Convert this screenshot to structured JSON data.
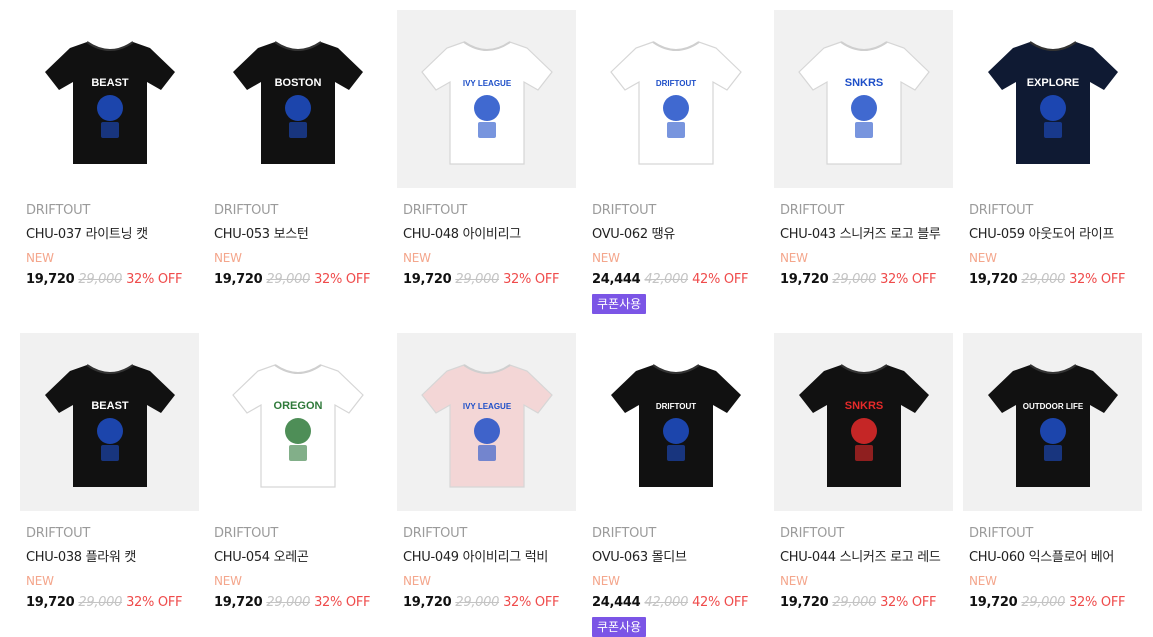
{
  "products": [
    {
      "brand": "DRIFTOUT",
      "name": "CHU-037 라이트닝 캣",
      "badge": "NEW",
      "price": "19,720",
      "original_price": "29,000",
      "discount": "32% OFF",
      "coupon": "",
      "shirt_color": "#111111",
      "bg": "white",
      "print_text": "BEAST",
      "icon": "black-tshirt-cat-print-icon"
    },
    {
      "brand": "DRIFTOUT",
      "name": "CHU-053 보스턴",
      "badge": "NEW",
      "price": "19,720",
      "original_price": "29,000",
      "discount": "32% OFF",
      "coupon": "",
      "shirt_color": "#111111",
      "bg": "white",
      "print_text": "BOSTON",
      "icon": "model-black-tshirt-bear-icon"
    },
    {
      "brand": "DRIFTOUT",
      "name": "CHU-048 아이비리그",
      "badge": "NEW",
      "price": "19,720",
      "original_price": "29,000",
      "discount": "32% OFF",
      "coupon": "",
      "shirt_color": "#ffffff",
      "bg": "grey",
      "print_text": "IVY LEAGUE",
      "icon": "model-white-tshirt-bear-icon"
    },
    {
      "brand": "DRIFTOUT",
      "name": "OVU-062 땡유",
      "badge": "NEW",
      "price": "24,444",
      "original_price": "42,000",
      "discount": "42% OFF",
      "coupon": "쿠폰사용",
      "shirt_color": "#ffffff",
      "bg": "white",
      "print_text": "DRIFTOUT",
      "icon": "white-tshirt-blue-v-icon"
    },
    {
      "brand": "DRIFTOUT",
      "name": "CHU-043 스니커즈 로고 블루",
      "badge": "NEW",
      "price": "19,720",
      "original_price": "29,000",
      "discount": "32% OFF",
      "coupon": "",
      "shirt_color": "#ffffff",
      "bg": "grey",
      "print_text": "SNKRS",
      "icon": "model-white-tshirt-snkrs-icon"
    },
    {
      "brand": "DRIFTOUT",
      "name": "CHU-059 아웃도어 라이프",
      "badge": "NEW",
      "price": "19,720",
      "original_price": "29,000",
      "discount": "32% OFF",
      "coupon": "",
      "shirt_color": "#0f1a33",
      "bg": "white",
      "print_text": "EXPLORE",
      "icon": "navy-tshirt-outdoor-print-icon"
    },
    {
      "brand": "DRIFTOUT",
      "name": "CHU-038 플라워 캣",
      "badge": "NEW",
      "price": "19,720",
      "original_price": "29,000",
      "discount": "32% OFF",
      "coupon": "",
      "shirt_color": "#111111",
      "bg": "grey",
      "print_text": "BEAST",
      "icon": "model-black-tshirt-flower-cat-icon"
    },
    {
      "brand": "DRIFTOUT",
      "name": "CHU-054 오레곤",
      "badge": "NEW",
      "price": "19,720",
      "original_price": "29,000",
      "discount": "32% OFF",
      "coupon": "",
      "shirt_color": "#ffffff",
      "bg": "white",
      "print_text": "OREGON",
      "icon": "white-tshirt-oregon-bear-icon"
    },
    {
      "brand": "DRIFTOUT",
      "name": "CHU-049 아이비리그 럭비",
      "badge": "NEW",
      "price": "19,720",
      "original_price": "29,000",
      "discount": "32% OFF",
      "coupon": "",
      "shirt_color": "#f3d6d6",
      "bg": "grey",
      "print_text": "IVY LEAGUE",
      "icon": "model-pink-tshirt-bear-icon"
    },
    {
      "brand": "DRIFTOUT",
      "name": "OVU-063 몰디브",
      "badge": "NEW",
      "price": "24,444",
      "original_price": "42,000",
      "discount": "42% OFF",
      "coupon": "쿠폰사용",
      "shirt_color": "#111111",
      "bg": "white",
      "print_text": "DRIFTOUT",
      "icon": "black-tshirt-skull-palm-icon"
    },
    {
      "brand": "DRIFTOUT",
      "name": "CHU-044 스니커즈 로고 레드",
      "badge": "NEW",
      "price": "19,720",
      "original_price": "29,000",
      "discount": "32% OFF",
      "coupon": "",
      "shirt_color": "#111111",
      "bg": "grey",
      "print_text": "SNKRS",
      "icon": "black-tshirt-red-snkrs-icon"
    },
    {
      "brand": "DRIFTOUT",
      "name": "CHU-060 익스플로어 베어",
      "badge": "NEW",
      "price": "19,720",
      "original_price": "29,000",
      "discount": "32% OFF",
      "coupon": "",
      "shirt_color": "#111111",
      "bg": "grey",
      "print_text": "OUTDOOR LIFE",
      "icon": "model-black-tshirt-explorer-bear-icon"
    }
  ]
}
